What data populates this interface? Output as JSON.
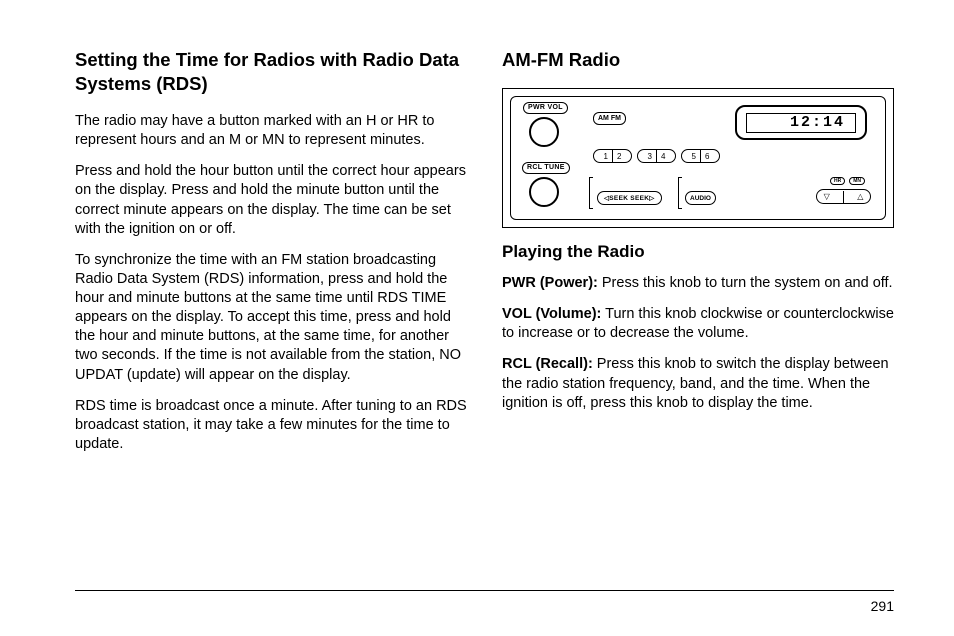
{
  "left": {
    "heading": "Setting the Time for Radios with Radio Data Systems (RDS)",
    "p1": "The radio may have a button marked with an H or HR to represent hours and an M or MN to represent minutes.",
    "p2": "Press and hold the hour button until the correct hour appears on the display. Press and hold the minute button until the correct minute appears on the display. The time can be set with the ignition on or off.",
    "p3": "To synchronize the time with an FM station broadcasting Radio Data System (RDS) information, press and hold the hour and minute buttons at the same time until RDS TIME appears on the display. To accept this time, press and hold the hour and minute buttons, at the same time, for another two seconds. If the time is not available from the station, NO UPDAT (update) will appear on the display.",
    "p4": "RDS time is broadcast once a minute. After tuning to an RDS broadcast station, it may take a few minutes for the time to update."
  },
  "right": {
    "heading": "AM-FM Radio",
    "sub": "Playing the Radio",
    "pwr_label": "PWR (Power):",
    "pwr_text": "  Press this knob to turn the system on and off.",
    "vol_label": "VOL (Volume):",
    "vol_text": "  Turn this knob clockwise or counterclockwise to increase or to decrease the volume.",
    "rcl_label": "RCL (Recall):",
    "rcl_text": "  Press this knob to switch the display between the radio station frequency, band, and the time. When the ignition is off, press this knob to display the time."
  },
  "radio": {
    "pwrvol": "PWR  VOL",
    "rcltune": "RCL  TUNE",
    "amfm": "AM  FM",
    "time": "12:14",
    "p1": "1",
    "p2": "2",
    "p3": "3",
    "p4": "4",
    "p5": "5",
    "p6": "6",
    "seek": "◁SEEK    SEEK▷",
    "audio": "AUDIO",
    "hr": "HR",
    "mn": "MN",
    "down": "▽",
    "up": "△"
  },
  "page": "291"
}
